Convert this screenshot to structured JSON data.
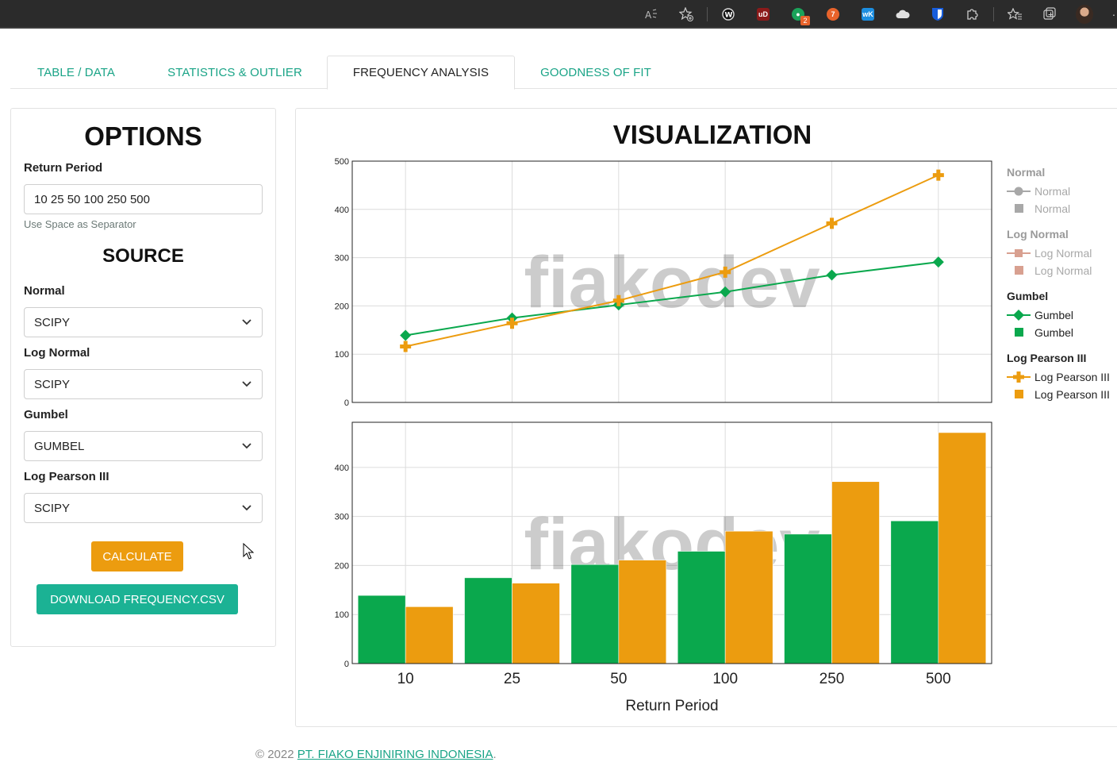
{
  "tabs": [
    {
      "label": "TABLE / DATA",
      "active": false
    },
    {
      "label": "STATISTICS & OUTLIER",
      "active": false
    },
    {
      "label": "FREQUENCY ANALYSIS",
      "active": true
    },
    {
      "label": "GOODNESS OF FIT",
      "active": false
    }
  ],
  "options": {
    "title": "OPTIONS",
    "return_period_label": "Return Period",
    "return_period_value": "10 25 50 100 250 500",
    "return_period_hint": "Use Space as Separator",
    "source_title": "SOURCE",
    "sources": [
      {
        "label": "Normal",
        "value": "SCIPY"
      },
      {
        "label": "Log Normal",
        "value": "SCIPY"
      },
      {
        "label": "Gumbel",
        "value": "GUMBEL"
      },
      {
        "label": "Log Pearson III",
        "value": "SCIPY"
      }
    ],
    "calculate_label": "CALCULATE",
    "download_label": "DOWNLOAD FREQUENCY.CSV"
  },
  "visualization": {
    "title": "VISUALIZATION",
    "watermark": "fiakodev"
  },
  "legend": {
    "groups": [
      {
        "title": "Normal",
        "line_label": "Normal",
        "bar_label": "Normal",
        "color": "#a8a8a8",
        "symbol": "circle",
        "muted": true
      },
      {
        "title": "Log Normal",
        "line_label": "Log Normal",
        "bar_label": "Log Normal",
        "color": "#d8a090",
        "symbol": "square",
        "muted": true
      },
      {
        "title": "Gumbel",
        "line_label": "Gumbel",
        "bar_label": "Gumbel",
        "color": "#0aa84d",
        "symbol": "diamond",
        "muted": false
      },
      {
        "title": "Log Pearson III",
        "line_label": "Log Pearson III",
        "bar_label": "Log Pearson III",
        "color": "#ec9c0f",
        "symbol": "cross",
        "muted": false
      }
    ]
  },
  "chart_data": [
    {
      "type": "line",
      "categories": [
        "10",
        "25",
        "50",
        "100",
        "250",
        "500"
      ],
      "series": [
        {
          "name": "Gumbel",
          "values": [
            139,
            175,
            202,
            229,
            264,
            291
          ],
          "color": "#0aa84d",
          "marker": "diamond"
        },
        {
          "name": "Log Pearson III",
          "values": [
            116,
            164,
            211,
            270,
            371,
            471
          ],
          "color": "#ec9c0f",
          "marker": "cross"
        }
      ],
      "ylim": [
        0,
        500
      ],
      "yticks": [
        0,
        100,
        200,
        300,
        400,
        500
      ],
      "grid": true
    },
    {
      "type": "bar",
      "categories": [
        "10",
        "25",
        "50",
        "100",
        "250",
        "500"
      ],
      "series": [
        {
          "name": "Gumbel",
          "values": [
            139,
            175,
            202,
            229,
            264,
            291
          ],
          "color": "#0aa84d"
        },
        {
          "name": "Log Pearson III",
          "values": [
            116,
            164,
            211,
            270,
            371,
            471
          ],
          "color": "#ec9c0f"
        }
      ],
      "ylim": [
        0,
        492
      ],
      "yticks": [
        0,
        100,
        200,
        300,
        400
      ],
      "xlabel": "Return Period",
      "grid": true
    }
  ],
  "footer": {
    "copyright": "© 2022",
    "company": "PT. FIAKO ENJINIRING INDONESIA",
    "suffix": "."
  }
}
